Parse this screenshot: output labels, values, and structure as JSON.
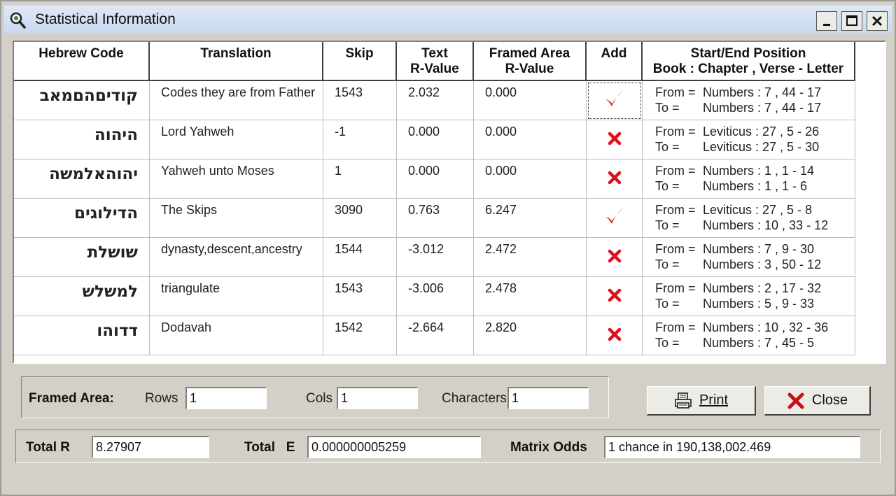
{
  "window": {
    "title": "Statistical Information"
  },
  "headers": {
    "hebrew": "Hebrew Code",
    "translation": "Translation",
    "skip": "Skip",
    "text_r1": "Text",
    "text_r2": "R-Value",
    "framed_r1": "Framed Area",
    "framed_r2": "R-Value",
    "add": "Add",
    "pos_r1": "Start/End Position",
    "pos_r2": "Book : Chapter , Verse - Letter"
  },
  "rows": [
    {
      "hebrew": "קודיםהםמאב",
      "translation": "Codes they are from Father",
      "skip": "1543",
      "text_r": "2.032",
      "framed_r": "0.000",
      "add": "check",
      "from_label": "From =",
      "from": "Numbers : 7 , 44 - 17",
      "to_label": "To =",
      "to": "Numbers : 7 , 44 - 17"
    },
    {
      "hebrew": "היהוה",
      "translation": "Lord Yahweh",
      "skip": "-1",
      "text_r": "0.000",
      "framed_r": "0.000",
      "add": "cross",
      "from_label": "From =",
      "from": "Leviticus : 27 , 5 - 26",
      "to_label": "To =",
      "to": "Leviticus : 27 , 5 - 30"
    },
    {
      "hebrew": "יהוהאלמשה",
      "translation": "Yahweh unto Moses",
      "skip": "1",
      "text_r": "0.000",
      "framed_r": "0.000",
      "add": "cross",
      "from_label": "From =",
      "from": "Numbers : 1 , 1 - 14",
      "to_label": "To =",
      "to": "Numbers : 1 , 1 - 6"
    },
    {
      "hebrew": "הדילוגים",
      "translation": "The Skips",
      "skip": "3090",
      "text_r": "0.763",
      "framed_r": "6.247",
      "add": "check",
      "from_label": "From =",
      "from": "Leviticus : 27 , 5 - 8",
      "to_label": "To =",
      "to": "Numbers : 10 , 33 - 12"
    },
    {
      "hebrew": "שושלת",
      "translation": "dynasty,descent,ancestry",
      "skip": "1544",
      "text_r": "-3.012",
      "framed_r": "2.472",
      "add": "cross",
      "from_label": "From =",
      "from": "Numbers : 7 , 9 - 30",
      "to_label": "To =",
      "to": "Numbers : 3 , 50 - 12"
    },
    {
      "hebrew": "למשלש",
      "translation": "triangulate",
      "skip": "1543",
      "text_r": "-3.006",
      "framed_r": "2.478",
      "add": "cross",
      "from_label": "From =",
      "from": "Numbers : 2 , 17 - 32",
      "to_label": "To =",
      "to": "Numbers : 5 , 9 - 33"
    },
    {
      "hebrew": "דדוהו",
      "translation": "Dodavah",
      "skip": "1542",
      "text_r": "-2.664",
      "framed_r": "2.820",
      "add": "cross",
      "from_label": "From =",
      "from": "Numbers : 10 , 32 - 36",
      "to_label": "To =",
      "to": "Numbers : 7 , 45 - 5"
    }
  ],
  "framed_area": {
    "label": "Framed Area:",
    "rows_label": "Rows",
    "rows_value": "1",
    "cols_label": "Cols",
    "cols_value": "1",
    "chars_label": "Characters",
    "chars_value": "1"
  },
  "buttons": {
    "print": "Print",
    "close": "Close"
  },
  "totals": {
    "total_r_label": "Total R",
    "total_r_value": "8.27907",
    "total_e_label": "Total   E",
    "total_e_value": "0.000000005259",
    "odds_label": "Matrix Odds",
    "odds_value": "1 chance in 190,138,002.469"
  },
  "colors": {
    "check": "#d8141b",
    "cross": "#e0101a",
    "title_bg": "#d6e3f5"
  }
}
